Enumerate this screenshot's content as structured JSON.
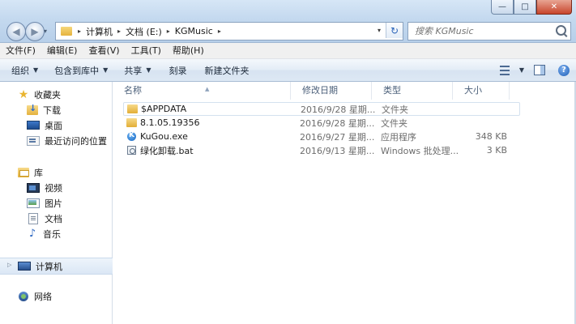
{
  "window": {
    "minimize_label": "—",
    "maximize_label": "□",
    "close_label": "✕"
  },
  "nav": {
    "back_label": "◀",
    "forward_label": "▶",
    "recent_label": "▾"
  },
  "address": {
    "crumbs": [
      "计算机",
      "文档 (E:)",
      "KGMusic"
    ],
    "separator": "▸",
    "dropdown_label": "▾",
    "refresh_label": "↻"
  },
  "search": {
    "placeholder": "搜索 KGMusic"
  },
  "menubar": {
    "items": [
      "文件(F)",
      "编辑(E)",
      "查看(V)",
      "工具(T)",
      "帮助(H)"
    ]
  },
  "commandbar": {
    "organize": "组织",
    "include_library": "包含到库中",
    "share": "共享",
    "burn": "刻录",
    "new_folder": "新建文件夹",
    "dropdown_arrow": "▼",
    "help_label": "?"
  },
  "navpane": {
    "favorites": "收藏夹",
    "downloads": "下载",
    "desktop": "桌面",
    "recent_places": "最近访问的位置",
    "libraries": "库",
    "videos": "视频",
    "pictures": "图片",
    "documents": "文档",
    "music": "音乐",
    "computer": "计算机",
    "network": "网络",
    "expand_arrow": "▷",
    "collapse_arrow": "◢",
    "star_glyph": "★",
    "music_glyph": "♪"
  },
  "columns": {
    "name": "名称",
    "date": "修改日期",
    "type": "类型",
    "size": "大小",
    "sort_arrow": "▲"
  },
  "files": [
    {
      "name": "$APPDATA",
      "date": "2016/9/28 星期...",
      "type": "文件夹",
      "size": "",
      "icon": "folder-icon"
    },
    {
      "name": "8.1.05.19356",
      "date": "2016/9/28 星期...",
      "type": "文件夹",
      "size": "",
      "icon": "folder-icon"
    },
    {
      "name": "KuGou.exe",
      "date": "2016/9/27 星期...",
      "type": "应用程序",
      "size": "348 KB",
      "icon": "kugou-app-icon"
    },
    {
      "name": "绿化卸载.bat",
      "date": "2016/9/13 星期...",
      "type": "Windows 批处理...",
      "size": "3 KB",
      "icon": "batch-file-icon"
    }
  ]
}
